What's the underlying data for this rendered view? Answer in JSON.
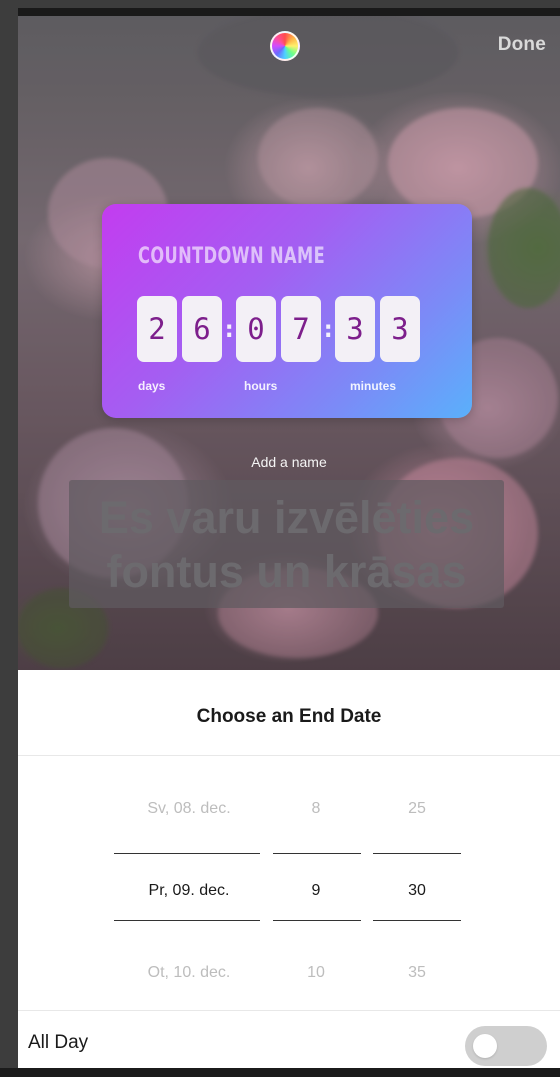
{
  "top_bar": {
    "done_label": "Done",
    "color_wheel_icon": "color-wheel-icon"
  },
  "sticker": {
    "name_placeholder": "COUNTDOWN NAME",
    "digits": [
      "2",
      "6",
      "0",
      "7",
      "3",
      "3"
    ],
    "units": {
      "days": "days",
      "hours": "hours",
      "minutes": "minutes"
    },
    "gradient_colors": [
      "#c33cf0",
      "#5ab0fb"
    ]
  },
  "add_name_hint": "Add a name",
  "text_overlay": {
    "line1": "Es varu izvēlēties",
    "line2": "fontus un krāsas"
  },
  "sheet": {
    "title": "Choose an End Date",
    "picker": {
      "rows": [
        {
          "date": "Sv, 08. dec.",
          "hour": "8",
          "minute": "25",
          "state": "dim"
        },
        {
          "date": "Pr, 09. dec.",
          "hour": "9",
          "minute": "30",
          "state": "selected"
        },
        {
          "date": "Ot, 10. dec.",
          "hour": "10",
          "minute": "35",
          "state": "dim"
        }
      ]
    },
    "all_day": {
      "label": "All Day",
      "enabled": false
    }
  }
}
